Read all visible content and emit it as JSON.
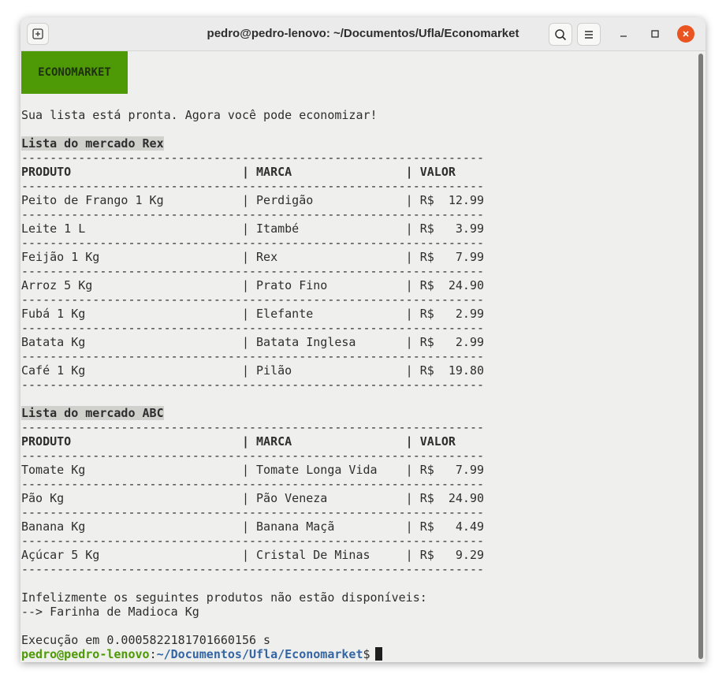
{
  "window": {
    "title": "pedro@pedro-lenovo: ~/Documentos/Ufla/Economarket"
  },
  "icons": {
    "new_tab": "new-tab-icon",
    "search": "search-icon",
    "menu": "hamburger-menu-icon",
    "minimize": "minimize-icon",
    "maximize": "maximize-icon",
    "close": "close-icon"
  },
  "colors": {
    "banner": "#4e9a06",
    "prompt_user": "#4e9a06",
    "prompt_path": "#3465a4",
    "close_button": "#e95420"
  },
  "terminal": {
    "banner": "ECONOMARKET",
    "intro": "Sua lista está pronta. Agora você pode economizar!",
    "separator": "-----------------------------------------------------------------",
    "stores": [
      {
        "title": "Lista do mercado Rex",
        "header": "PRODUTO                        | MARCA                | VALOR",
        "rows": [
          "Peito de Frango 1 Kg           | Perdigão             | R$  12.99",
          "Leite 1 L                      | Itambé               | R$   3.99",
          "Feijão 1 Kg                    | Rex                  | R$   7.99",
          "Arroz 5 Kg                     | Prato Fino           | R$  24.90",
          "Fubá 1 Kg                      | Elefante             | R$   2.99",
          "Batata Kg                      | Batata Inglesa       | R$   2.99",
          "Café 1 Kg                      | Pilão                | R$  19.80"
        ]
      },
      {
        "title": "Lista do mercado ABC",
        "header": "PRODUTO                        | MARCA                | VALOR",
        "rows": [
          "Tomate Kg                      | Tomate Longa Vida    | R$   7.99",
          "Pão Kg                         | Pão Veneza           | R$  24.90",
          "Banana Kg                      | Banana Maçã          | R$   4.49",
          "Açúcar 5 Kg                    | Cristal De Minas     | R$   9.29"
        ]
      }
    ],
    "unavailable_msg": "Infelizmente os seguintes produtos não estão disponíveis:",
    "unavailable_items": [
      "--> Farinha de Madioca Kg"
    ],
    "exec_time": "Execução em 0.0005822181701660156 s",
    "prompt_user": "pedro@pedro-lenovo",
    "prompt_sep": ":",
    "prompt_path": "~/Documentos/Ufla/Economarket",
    "prompt_symbol": "$"
  }
}
